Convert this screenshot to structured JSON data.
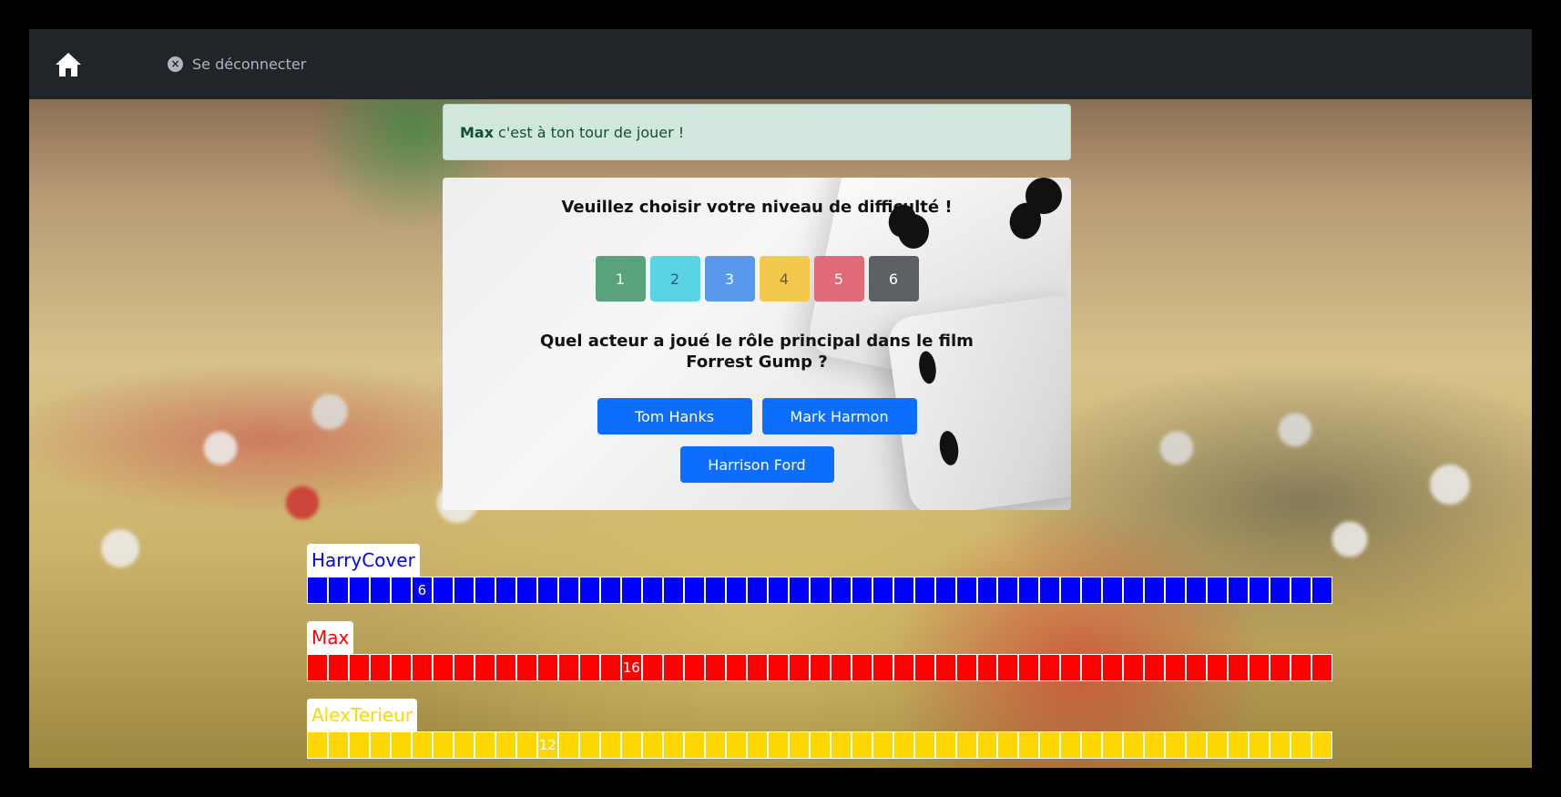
{
  "nav": {
    "logout_label": "Se déconnecter"
  },
  "alert": {
    "player": "Max",
    "message": "c'est à ton tour de jouer !"
  },
  "quiz": {
    "title": "Veuillez choisir votre niveau de difficulté !",
    "levels": [
      {
        "label": "1",
        "color": "#5aa27c"
      },
      {
        "label": "2",
        "color": "#5bd3e6"
      },
      {
        "label": "3",
        "color": "#5a98ec"
      },
      {
        "label": "4",
        "color": "#f2c94c"
      },
      {
        "label": "5",
        "color": "#e06a78"
      },
      {
        "label": "6",
        "color": "#5d6166"
      }
    ],
    "question": "Quel acteur a joué le rôle principal dans le film Forrest Gump ?",
    "answers": [
      "Tom Hanks",
      "Mark Harmon",
      "Harrison Ford"
    ]
  },
  "players": [
    {
      "name": "HarryCover",
      "color": "#0000ff",
      "position": 6
    },
    {
      "name": "Max",
      "color": "#ff0000",
      "position": 16
    },
    {
      "name": "AlexTerieur",
      "color": "#ffd700",
      "position": 12
    }
  ],
  "track_cells": 49
}
